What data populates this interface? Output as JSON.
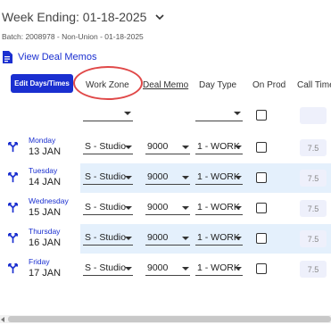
{
  "header": {
    "week_label": "Week Ending: 01-18-2025",
    "batch": "Batch: 2008978 - Non-Union - 01-18-2025",
    "view_deal_memos": "View Deal Memos"
  },
  "columns": {
    "edit_button": "Edit Days/Times",
    "work_zone": "Work Zone",
    "deal_memo": "Deal Memo",
    "day_type": "Day Type",
    "on_prod": "On Prod",
    "call_time": "Call Time"
  },
  "rows": [
    {
      "dow": "Monday",
      "date": "13 JAN",
      "zone": "S - Studio",
      "deal": "9000",
      "day_type": "1 - WORK",
      "call": "7.5"
    },
    {
      "dow": "Tuesday",
      "date": "14 JAN",
      "zone": "S - Studio",
      "deal": "9000",
      "day_type": "1 - WORK",
      "call": "7.5"
    },
    {
      "dow": "Wednesday",
      "date": "15 JAN",
      "zone": "S - Studio",
      "deal": "9000",
      "day_type": "1 - WORK",
      "call": "7.5"
    },
    {
      "dow": "Thursday",
      "date": "16 JAN",
      "zone": "S - Studio",
      "deal": "9000",
      "day_type": "1 - WORK",
      "call": "7.5"
    },
    {
      "dow": "Friday",
      "date": "17 JAN",
      "zone": "S - Studio",
      "deal": "9000",
      "day_type": "1 - WORK",
      "call": "7.5"
    }
  ],
  "colors": {
    "accent": "#1a2fd0",
    "highlight_ring": "#e04848",
    "alt_row": "#e4f0fc"
  }
}
